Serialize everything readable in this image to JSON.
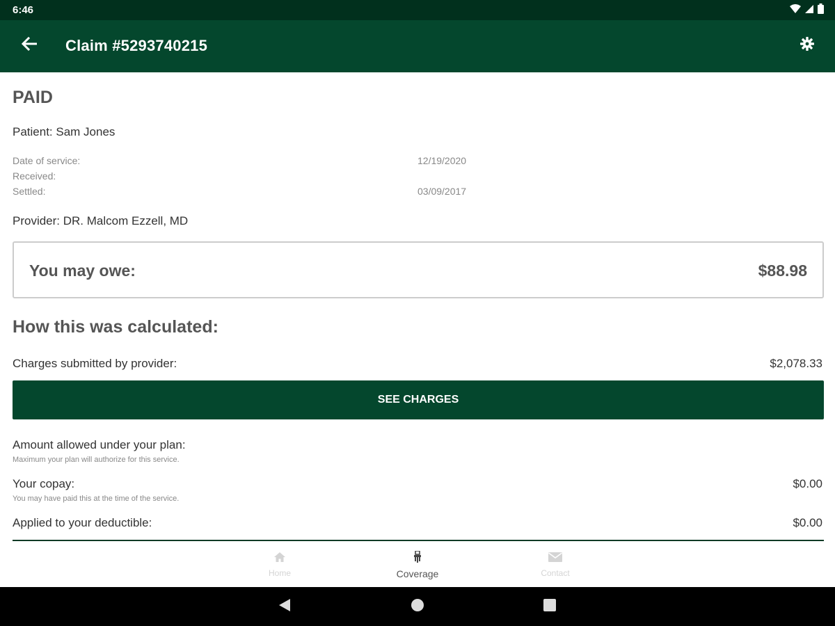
{
  "status_bar": {
    "time": "6:46",
    "icons": [
      "wifi-icon",
      "cell-signal-icon",
      "battery-icon"
    ]
  },
  "app_bar": {
    "title": "Claim #5293740215",
    "back_icon": "arrow-left-icon",
    "settings_icon": "gear-icon"
  },
  "claim": {
    "status": "PAID",
    "patient": "Patient: Sam Jones",
    "dates": [
      {
        "label": "Date of service:",
        "value": "12/19/2020"
      },
      {
        "label": "Received:",
        "value": ""
      },
      {
        "label": "Settled:",
        "value": "03/09/2017"
      }
    ],
    "provider": "Provider: DR. Malcom Ezzell, MD"
  },
  "owe": {
    "label": "You may owe:",
    "amount": "$88.98"
  },
  "calculation": {
    "heading": "How this was calculated:",
    "charges_label": "Charges submitted by provider:",
    "charges_value": "$2,078.33",
    "see_charges_label": "SEE CHARGES",
    "allowed_label": "Amount allowed under your plan:",
    "allowed_sub": "Maximum your plan will authorize for this service.",
    "copay_label": "Your copay:",
    "copay_sub": "You may have paid this at the time of the service.",
    "copay_value": "$0.00",
    "deductible_label": "Applied to your deductible:",
    "deductible_value": "$0.00"
  },
  "bottom_nav": {
    "items": [
      {
        "label": "Home",
        "icon": "home-icon",
        "active": false
      },
      {
        "label": "Coverage",
        "icon": "coverage-icon",
        "active": true
      },
      {
        "label": "Contact",
        "icon": "envelope-icon",
        "active": false
      }
    ]
  },
  "colors": {
    "primary": "#04472d",
    "status_bar": "#01301d"
  }
}
